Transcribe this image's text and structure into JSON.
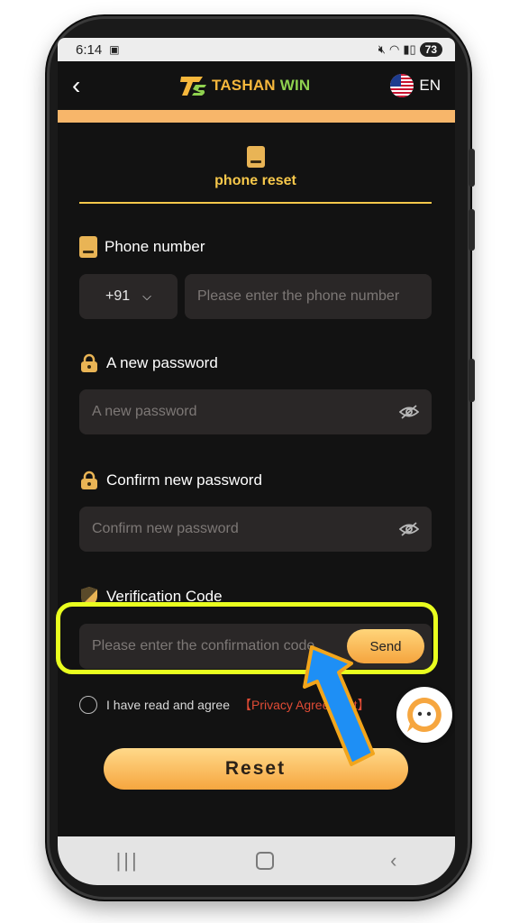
{
  "status": {
    "time": "6:14",
    "battery": "73"
  },
  "header": {
    "logo_prefix": "TASHAN",
    "logo_suffix": "WIN",
    "lang": "EN"
  },
  "tab": {
    "title": "phone reset"
  },
  "phone": {
    "label": "Phone number",
    "country_code": "+91",
    "placeholder": "Please enter the phone number"
  },
  "password": {
    "label": "A new password",
    "placeholder": "A new password"
  },
  "confirm": {
    "label": "Confirm new password",
    "placeholder": "Confirm new password"
  },
  "verification": {
    "label": "Verification Code",
    "placeholder": "Please enter the confirmation code",
    "send_label": "Send"
  },
  "agreement": {
    "text": "I have read and agree",
    "link": "【Privacy Agreement】"
  },
  "actions": {
    "reset_label": "Reset"
  },
  "colors": {
    "accent": "#f7c84b",
    "highlight": "#e9ff1f",
    "arrow": "#1e8ff5"
  }
}
